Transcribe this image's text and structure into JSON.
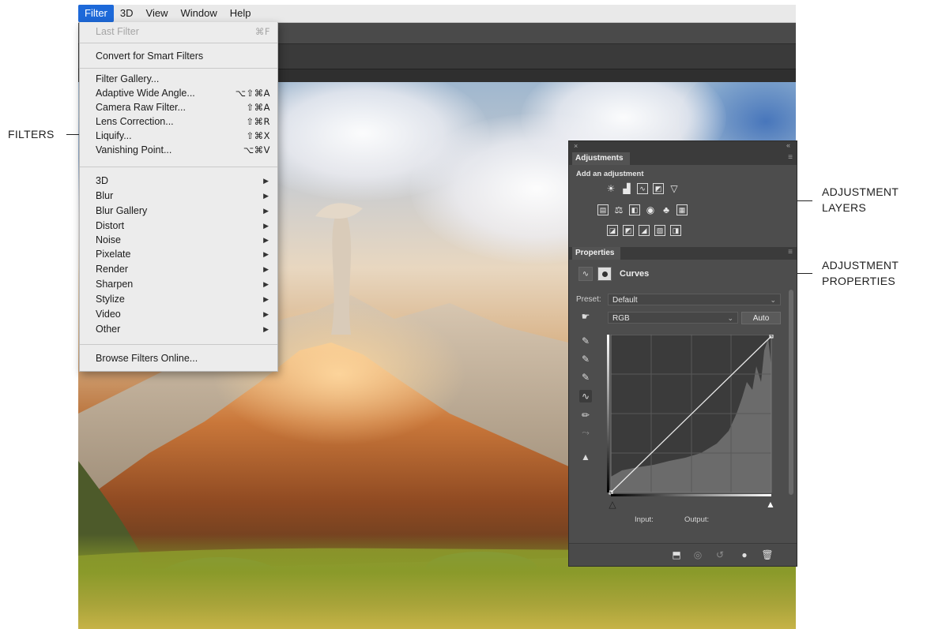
{
  "menubar": {
    "items": [
      {
        "label": "Filter",
        "active": true
      },
      {
        "label": "3D"
      },
      {
        "label": "View"
      },
      {
        "label": "Window"
      },
      {
        "label": "Help"
      }
    ]
  },
  "filter_menu": {
    "last_filter": {
      "label": "Last Filter",
      "shortcut": "⌘F"
    },
    "convert": "Convert for Smart Filters",
    "filters": [
      {
        "label": "Filter Gallery...",
        "shortcut": ""
      },
      {
        "label": "Adaptive Wide Angle...",
        "shortcut": "⌥⇧⌘A"
      },
      {
        "label": "Camera Raw Filter...",
        "shortcut": "⇧⌘A"
      },
      {
        "label": "Lens Correction...",
        "shortcut": "⇧⌘R"
      },
      {
        "label": "Liquify...",
        "shortcut": "⇧⌘X"
      },
      {
        "label": "Vanishing Point...",
        "shortcut": "⌥⌘V"
      }
    ],
    "submenus": [
      "3D",
      "Blur",
      "Blur Gallery",
      "Distort",
      "Noise",
      "Pixelate",
      "Render",
      "Sharpen",
      "Stylize",
      "Video",
      "Other"
    ],
    "browse": "Browse Filters Online..."
  },
  "adjustments_panel": {
    "close_glyph": "×",
    "collapse_glyph": "«",
    "menu_glyph": "≡",
    "tab": "Adjustments",
    "caption": "Add an adjustment",
    "icons_row1": [
      "brightness-contrast-icon",
      "levels-icon",
      "curves-icon",
      "exposure-icon",
      "vibrance-icon"
    ],
    "icons_row2": [
      "hue-saturation-icon",
      "color-balance-icon",
      "black-white-icon",
      "photo-filter-icon",
      "channel-mixer-icon",
      "color-lookup-icon"
    ],
    "icons_row3": [
      "invert-icon",
      "posterize-icon",
      "threshold-icon",
      "gradient-map-icon",
      "selective-color-icon"
    ]
  },
  "properties_panel": {
    "tab": "Properties",
    "menu_glyph": "≡",
    "title": "Curves",
    "preset_label": "Preset:",
    "preset_value": "Default",
    "channel_value": "RGB",
    "auto_label": "Auto",
    "input_label": "Input:",
    "output_label": "Output:",
    "tools": [
      "on-image-adjust-icon",
      "black-point-eyedropper-icon",
      "gray-point-eyedropper-icon",
      "white-point-eyedropper-icon",
      "point-curve-icon",
      "pencil-icon",
      "smooth-icon",
      "clipping-warning-icon"
    ],
    "footer_icons": [
      "clip-to-layer-icon",
      "view-previous-icon",
      "reset-icon",
      "visibility-icon",
      "delete-icon"
    ]
  },
  "callouts": {
    "filters": "FILTERS",
    "adjustment_layers": [
      "ADJUSTMENT",
      "LAYERS"
    ],
    "adjustment_properties": [
      "ADJUSTMENT",
      "PROPERTIES"
    ]
  },
  "colors": {
    "menu_highlight": "#1d69d9",
    "panel_bg": "#4d4d4d",
    "menu_bg": "#ececec"
  }
}
